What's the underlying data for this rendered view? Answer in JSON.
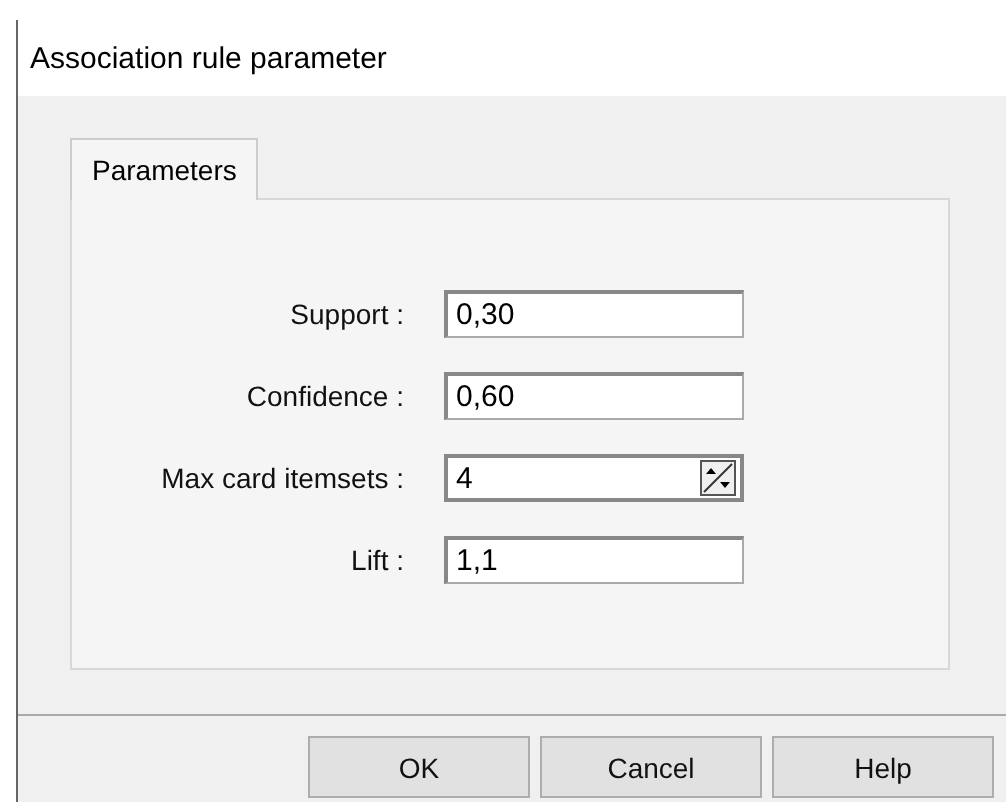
{
  "window": {
    "title": "Association rule parameter"
  },
  "tabs": [
    {
      "label": "Parameters",
      "selected": true
    }
  ],
  "fields": [
    {
      "label": "Support :",
      "value": "0,30",
      "kind": "text"
    },
    {
      "label": "Confidence :",
      "value": "0,60",
      "kind": "text"
    },
    {
      "label": "Max card itemsets :",
      "value": "4",
      "kind": "spin"
    },
    {
      "label": "Lift :",
      "value": "1,1",
      "kind": "text"
    }
  ],
  "buttons": [
    "OK",
    "Cancel",
    "Help"
  ]
}
